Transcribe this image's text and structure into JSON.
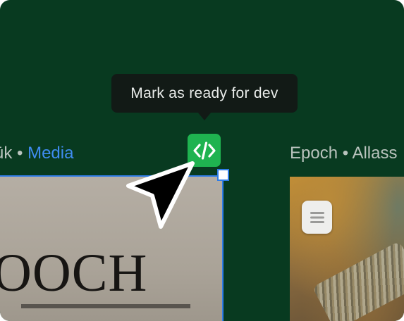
{
  "tooltip": {
    "text": "Mark as ready for dev"
  },
  "dev_mode_button": {
    "icon": "code-icon"
  },
  "frames": {
    "left": {
      "label_prefix": "ūk •",
      "label_accent": "Media",
      "poster_text": "OOCH"
    },
    "right": {
      "label": "Epoch • Allass",
      "icon": "document-icon"
    }
  },
  "colors": {
    "canvas": "#083a20",
    "tooltip_bg": "#121a16",
    "button_green": "#1fb350",
    "selection_blue": "#2f7de8",
    "label_accent": "#3f8cf0"
  }
}
